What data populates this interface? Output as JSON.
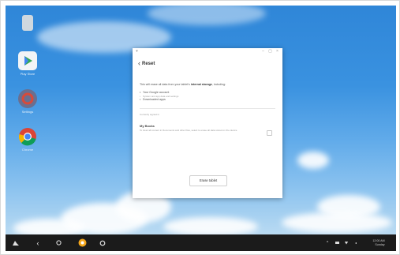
{
  "desktop": {
    "icons": [
      {
        "name": "trash-icon",
        "label": "",
        "color": "#cfd8df"
      },
      {
        "name": "play-store-icon",
        "label": "Play Store",
        "color": "#e8eef2"
      },
      {
        "name": "settings-icon",
        "label": "Settings",
        "color": "#6b6f8f"
      },
      {
        "name": "chrome-icon",
        "label": "Chrome",
        "color": "#e8e8e8"
      }
    ]
  },
  "dialog": {
    "header_title": "Reset",
    "intro_prefix": "This will erase all data from your tablet's",
    "intro_bold": "internal storage",
    "intro_suffix": ", including:",
    "bullets": [
      "Your Google account",
      "System and app data and settings",
      "Downloaded apps"
    ],
    "section_hint": "Currently signed in",
    "option_title": "My Books",
    "option_description": "To clear all content in Documents and other files, select to erase all data stored on the device",
    "erase_button": "Erase tablet"
  },
  "taskbar": {
    "tray_time": "12:00 AM",
    "tray_date": "Sunday"
  }
}
